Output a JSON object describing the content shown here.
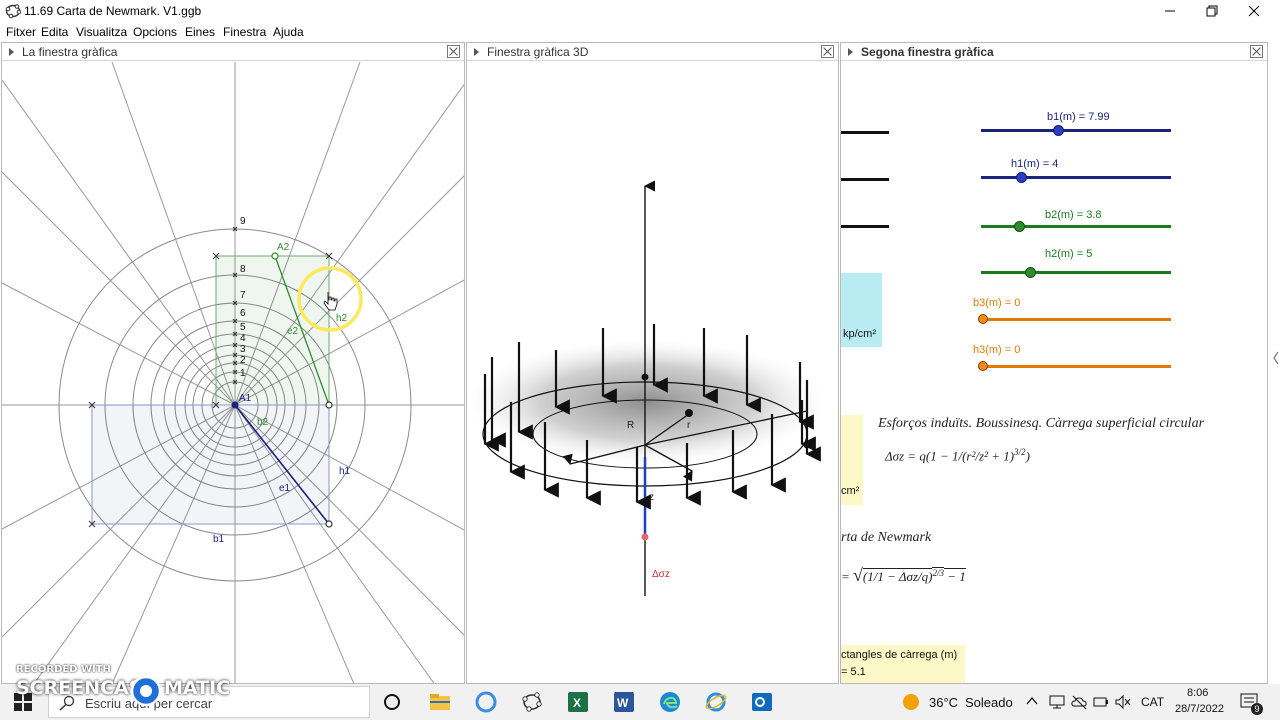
{
  "window": {
    "title": "11.69 Carta de Newmark. V1.ggb"
  },
  "menu": [
    "Fitxer",
    "Edita",
    "Visualitza",
    "Opcions",
    "Eines",
    "Finestra",
    "Ajuda"
  ],
  "panels": {
    "graphics1": {
      "title": "La finestra gràfica"
    },
    "graphics3d": {
      "title": "Finestra gràfica 3D"
    },
    "graphics2": {
      "title": "Segona finestra gràfica"
    }
  },
  "graph1_labels": {
    "ring_numbers": [
      "9",
      "8",
      "7",
      "6",
      "5",
      "4",
      "3",
      "2",
      "1"
    ],
    "A1": "A1",
    "A2": "A2",
    "e2": "e2",
    "h2": "h2",
    "b2": "b2",
    "h1": "h1",
    "e1": "e1",
    "b1": "b1"
  },
  "graph3d_labels": {
    "R": "R",
    "r": "r",
    "z": "z",
    "dsigma": "Δσz"
  },
  "sliders": [
    {
      "label": "b1(m) = 7.99",
      "color": "#1a237e",
      "value": 7.99
    },
    {
      "label": "h1(m) = 4",
      "color": "#1a237e",
      "value": 4
    },
    {
      "label": "b2(m) = 3.8",
      "color": "#1b7a1b",
      "value": 3.8
    },
    {
      "label": "h2(m) = 5",
      "color": "#1b7a1b",
      "value": 5
    },
    {
      "label": "b3(m) = 0",
      "color": "#e07b00",
      "value": 0
    },
    {
      "label": "h3(m) = 0",
      "color": "#e07b00",
      "value": 0
    }
  ],
  "graph2": {
    "unit1": "kp/cm²",
    "unit2": "cm²",
    "heading1": "Esforços induïts. Boussinesq. Càrrega superficial circular",
    "formula1": "Δσz = q(1 − 1/(r²/z² + 1)",
    "formula1_exp": "3/2",
    "heading2": "rta de Newmark",
    "formula2_prefix": "= ",
    "formula2": "(1/1 − Δσz/q)",
    "formula2_exp": "2/3",
    "formula2_suffix": " − 1",
    "box_line1": "ctangles de càrrega (m)",
    "box_line2": "= 5.1"
  },
  "taskbar": {
    "search_placeholder": "Escriu aquí per cercar",
    "temperature": "36°C",
    "weather": "Soleado",
    "lang": "CAT",
    "time": "8:06",
    "date": "28/7/2022",
    "notif_count": "9"
  },
  "watermark": {
    "line1": "RECORDED WITH",
    "line2": "SCREENCAST",
    "line3": "MATIC"
  }
}
